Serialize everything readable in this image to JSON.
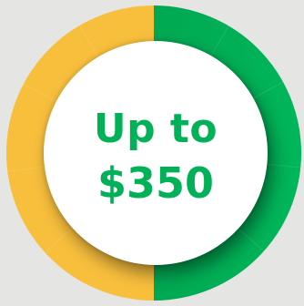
{
  "badge": {
    "line_1": "Up to",
    "line_2": "$350"
  },
  "ring": {
    "left_color": "#f8bf3d",
    "right_color": "#00b157",
    "right_dark_color": "#008f45"
  },
  "text_color": "#00b157"
}
